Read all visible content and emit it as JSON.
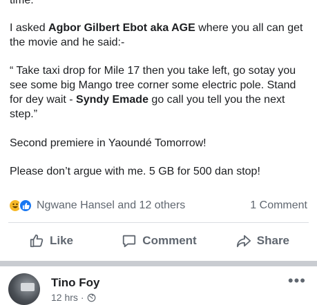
{
  "post": {
    "top_fragment": "time.",
    "paragraphs": {
      "p1_before": "I asked ",
      "p1_bold": "Agbor Gilbert Ebot aka AGE",
      "p1_after": " where you all can get the movie and he said:-",
      "p2_before": "“ Take taxi drop for Mile 17 then you take left, go sotay you see some big Mango tree corner some electric pole. Stand for dey wait - ",
      "p2_bold": "Syndy Emade",
      "p2_after": " go call you tell you the next step.”",
      "p3": "Second premiere in Yaoundé Tomorrow!",
      "p4": "Please don’t argue with me. 5 GB for 500 dan stop!"
    },
    "reactions": {
      "icons": [
        "haha-icon",
        "like-icon"
      ],
      "text": "Ngwane Hansel and 12 others",
      "comments": "1 Comment"
    },
    "actions": {
      "like": "Like",
      "comment": "Comment",
      "share": "Share"
    }
  },
  "next_post": {
    "author": "Tino Foy",
    "time": "12 hrs",
    "separator": "·",
    "privacy_icon": "globe-icon",
    "more_icon": "more-icon"
  },
  "colors": {
    "text": "#1c1e21",
    "secondary": "#606770",
    "like_blue": "#1877f2",
    "haha_yellow": "#f7b928",
    "separator": "#c9ccd1"
  }
}
